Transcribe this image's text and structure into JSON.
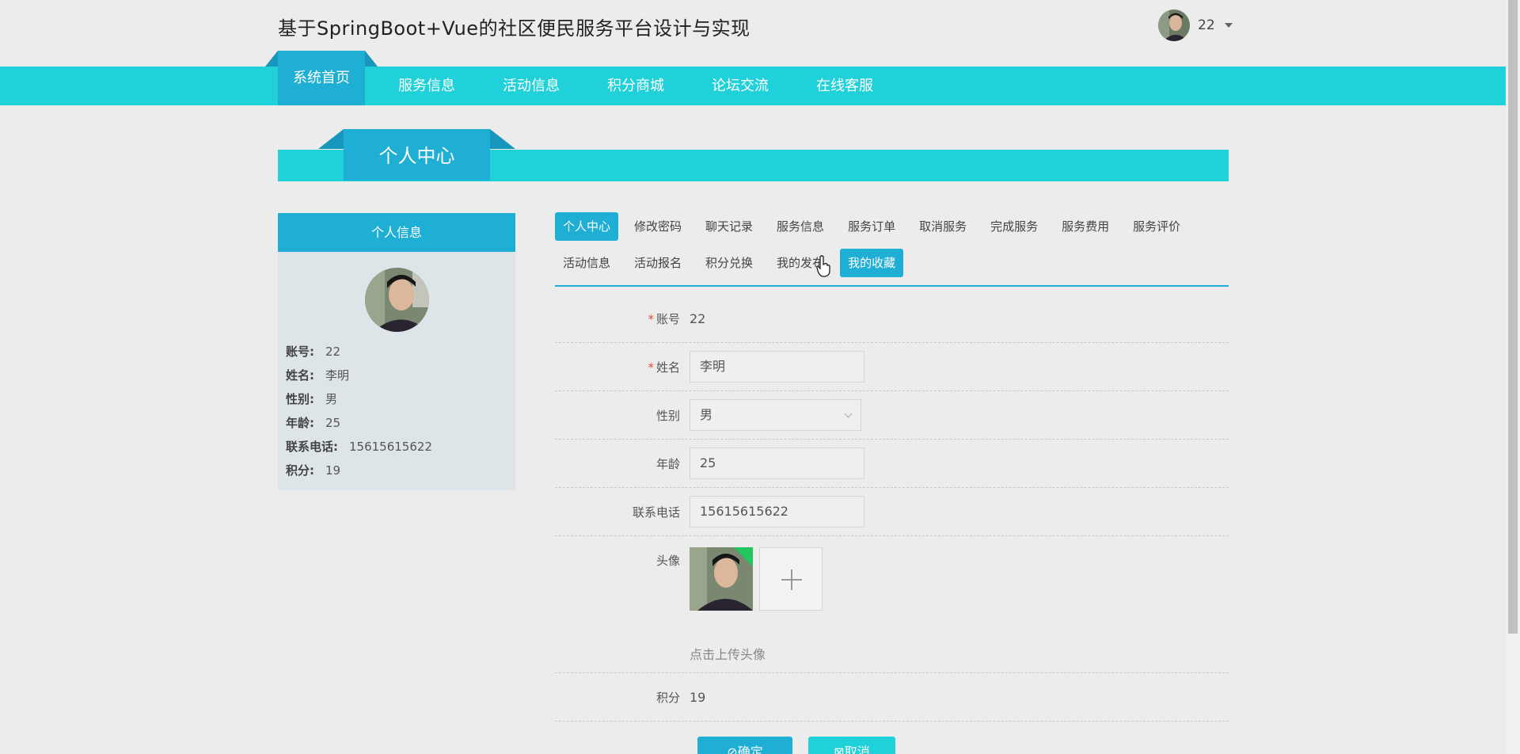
{
  "site": {
    "title": "基于SpringBoot+Vue的社区便民服务平台设计与实现",
    "username": "22"
  },
  "nav": {
    "items": [
      {
        "label": "系统首页",
        "active": true
      },
      {
        "label": "服务信息"
      },
      {
        "label": "活动信息"
      },
      {
        "label": "积分商城"
      },
      {
        "label": "论坛交流"
      },
      {
        "label": "在线客服"
      }
    ]
  },
  "banner": {
    "title": "个人中心"
  },
  "profile": {
    "header": "个人信息",
    "rows": [
      {
        "key": "账号:",
        "value": "22"
      },
      {
        "key": "姓名:",
        "value": "李明"
      },
      {
        "key": "性别:",
        "value": "男"
      },
      {
        "key": "年龄:",
        "value": "25"
      },
      {
        "key": "联系电话:",
        "value": "15615615622"
      },
      {
        "key": "积分:",
        "value": "19"
      }
    ]
  },
  "tabs": {
    "row1": [
      "个人中心",
      "修改密码",
      "聊天记录",
      "服务信息",
      "服务订单",
      "取消服务",
      "完成服务",
      "服务费用",
      "服务评价"
    ],
    "row2": [
      "活动信息",
      "活动报名",
      "积分兑换",
      "我的发布",
      "我的收藏"
    ]
  },
  "form": {
    "account_label": "账号",
    "account_value": "22",
    "name_label": "姓名",
    "name_value": "李明",
    "gender_label": "性别",
    "gender_value": "男",
    "age_label": "年龄",
    "age_value": "25",
    "phone_label": "联系电话",
    "phone_value": "15615615622",
    "avatar_label": "头像",
    "upload_hint": "点击上传头像",
    "points_label": "积分",
    "points_value": "19",
    "confirm": "⊘确定",
    "cancel": "⊠取消"
  },
  "colors": {
    "nav": "#21d1d9",
    "accent": "#1faed4",
    "card": "#dde5e8"
  }
}
